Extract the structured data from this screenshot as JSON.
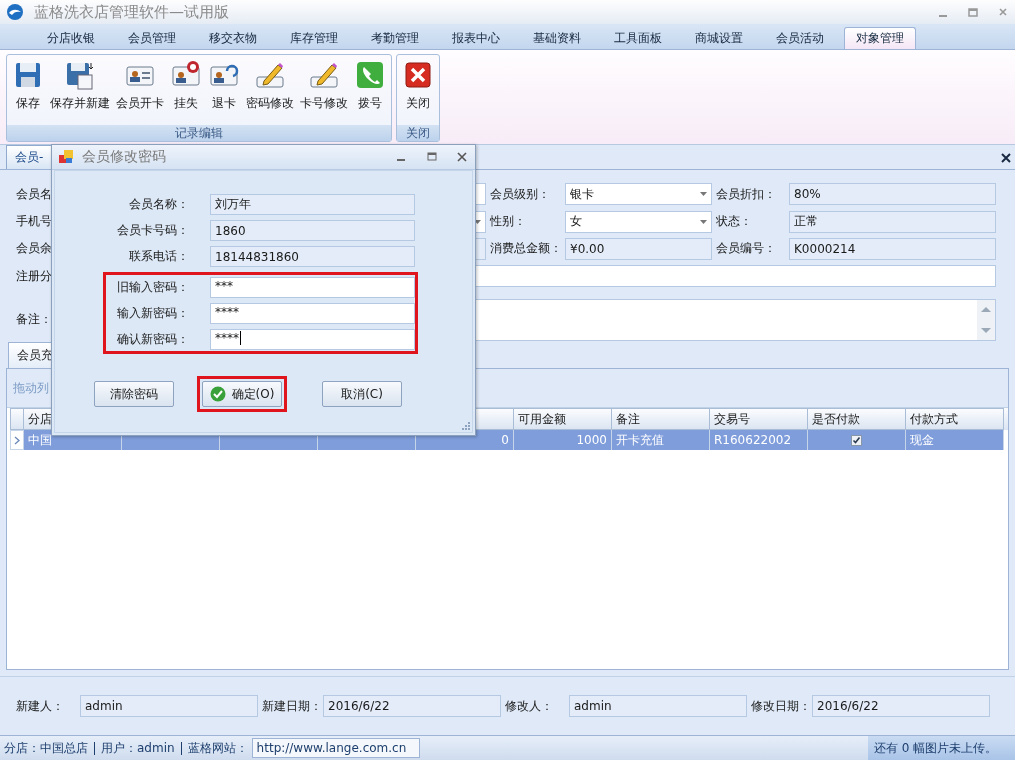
{
  "window": {
    "title": "蓝格洗衣店管理软件—试用版"
  },
  "menu_tabs": [
    {
      "label": "分店收银",
      "selected": false
    },
    {
      "label": "会员管理",
      "selected": false
    },
    {
      "label": "移交衣物",
      "selected": false
    },
    {
      "label": "库存管理",
      "selected": false
    },
    {
      "label": "考勤管理",
      "selected": false
    },
    {
      "label": "报表中心",
      "selected": false
    },
    {
      "label": "基础资料",
      "selected": false
    },
    {
      "label": "工具面板",
      "selected": false
    },
    {
      "label": "商城设置",
      "selected": false
    },
    {
      "label": "会员活动",
      "selected": false
    },
    {
      "label": "对象管理",
      "selected": true
    }
  ],
  "ribbon": {
    "groups": [
      {
        "caption": "记录编辑",
        "buttons": [
          {
            "label": "保存",
            "kind": "save"
          },
          {
            "label": "保存并新建",
            "kind": "save_new"
          },
          {
            "label": "会员开卡",
            "kind": "card"
          },
          {
            "label": "挂失",
            "kind": "lost"
          },
          {
            "label": "退卡",
            "kind": "return"
          },
          {
            "label": "密码修改",
            "kind": "edit"
          },
          {
            "label": "卡号修改",
            "kind": "edit"
          },
          {
            "label": "拨号",
            "kind": "dial"
          }
        ]
      },
      {
        "caption": "关闭",
        "buttons": [
          {
            "label": "关闭",
            "kind": "close"
          }
        ]
      }
    ]
  },
  "document_tab": {
    "label": "会员-"
  },
  "member_form": {
    "rows": [
      {
        "items": [
          {
            "label": "会员名",
            "kind": "text"
          },
          {
            "label": "会员级别：",
            "kind": "combo",
            "value": "银卡"
          },
          {
            "label": "会员折扣：",
            "kind": "readonly",
            "value": "80%"
          }
        ]
      },
      {
        "items": [
          {
            "label": "手机号",
            "kind": "combo"
          },
          {
            "label": "性别：",
            "kind": "combo",
            "value": "女"
          },
          {
            "label": "状态：",
            "kind": "readonly",
            "value": "正常"
          }
        ]
      },
      {
        "items": [
          {
            "label": "会员余",
            "kind": "readonly"
          },
          {
            "label": "消费总金额：",
            "kind": "readonly",
            "value": "¥0.00"
          },
          {
            "label": "会员编号：",
            "kind": "readonly",
            "value": "K0000214"
          }
        ]
      },
      {
        "items": [
          {
            "label": "注册分",
            "kind": "wide"
          }
        ]
      },
      {
        "items": [
          {
            "label": "备注：",
            "kind": "memo"
          }
        ]
      }
    ]
  },
  "recharge_tab": {
    "label": "会员充"
  },
  "grid": {
    "hint": "拖动列",
    "columns": [
      {
        "label": "分店",
        "kind": "text"
      },
      {
        "kind": "text"
      },
      {
        "kind": "text"
      },
      {
        "kind": "number"
      },
      {
        "kind": "number"
      },
      {
        "label": "可用金额",
        "kind": "number"
      },
      {
        "label": "备注",
        "kind": "text"
      },
      {
        "label": "交易号",
        "kind": "text"
      },
      {
        "label": "是否付款",
        "kind": "check"
      },
      {
        "label": "付款方式",
        "kind": "text"
      }
    ],
    "rows": [
      {
        "selected": true,
        "cells": [
          "中国",
          null,
          null,
          null,
          "0",
          "1000",
          "开卡充值",
          "R160622002",
          true,
          "现金"
        ]
      }
    ]
  },
  "record_footer": [
    {
      "label": "新建人：",
      "value": "admin"
    },
    {
      "label": "新建日期：",
      "value": "2016/6/22"
    },
    {
      "label": "修改人：",
      "value": "admin"
    },
    {
      "label": "修改日期：",
      "value": "2016/6/22"
    }
  ],
  "status_bar": {
    "branch": "分店：中国总店",
    "user": "用户：admin",
    "site_label": "蓝格网站：",
    "site_url": "http://www.lange.com.cn",
    "upload": "还有 0 幅图片未上传。"
  },
  "dialog": {
    "title": "会员修改密码",
    "fields": [
      {
        "label": "会员名称：",
        "value": "刘万年"
      },
      {
        "label": "会员卡号码：",
        "value": "1860"
      },
      {
        "label": "联系电话：",
        "value": "18144831860"
      }
    ],
    "password_group": {
      "highlighted": true,
      "fields": [
        {
          "label": "旧输入密码：",
          "value": "***",
          "focused": false
        },
        {
          "label": "输入新密码：",
          "value": "****",
          "focused": false
        },
        {
          "label": "确认新密码：",
          "value": "****",
          "focused": true
        }
      ]
    },
    "buttons": [
      {
        "label": "清除密码",
        "kind": "plain",
        "highlighted": false
      },
      {
        "label": "确定(O)",
        "kind": "ok",
        "highlighted": true
      },
      {
        "label": "取消(C)",
        "kind": "plain",
        "highlighted": false
      }
    ]
  }
}
